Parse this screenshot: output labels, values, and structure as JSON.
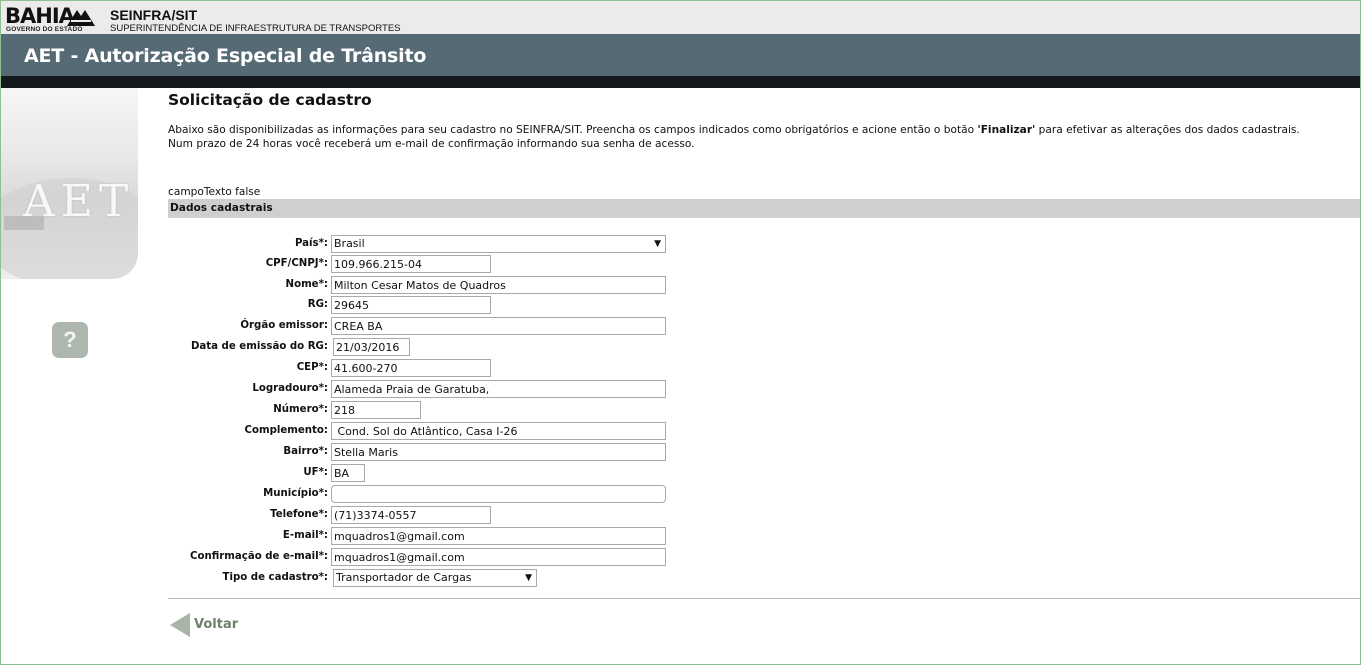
{
  "header": {
    "logo_text": "BAHIA",
    "logo_subtitle": "GOVERNO DO ESTADO",
    "org_name": "SEINFRA/SIT",
    "org_subtitle": "SUPERINTENDÊNCIA DE INFRAESTRUTURA DE TRANSPORTES",
    "app_title": "AET - Autorização Especial de Trânsito"
  },
  "sidebar": {
    "art_text": "AET",
    "help_label": "?"
  },
  "page": {
    "title": "Solicitação de cadastro",
    "intro_part1": "Abaixo são disponibilizadas as informações para seu cadastro no SEINFRA/SIT. Preencha os campos indicados como obrigatórios e acione então o botão ",
    "intro_bold": "'Finalizar'",
    "intro_part2": " para efetivar as alterações dos dados cadastrais.",
    "intro_line2": "Num prazo de 24 horas você receberá um e-mail de confirmação informando sua senha de acesso.",
    "debug_text": "campoTexto false",
    "section_title": "Dados cadastrais"
  },
  "form": {
    "pais": {
      "label": "País*:",
      "value": "Brasil"
    },
    "cpf": {
      "label": "CPF/CNPJ*:",
      "value": "109.966.215-04"
    },
    "nome": {
      "label": "Nome*:",
      "value": "Milton Cesar Matos de Quadros"
    },
    "rg": {
      "label": "RG:",
      "value": "29645"
    },
    "orgao": {
      "label": "Órgão emissor:",
      "value": "CREA BA"
    },
    "data_rg": {
      "label": "Data de emissão do RG:",
      "value": "21/03/2016"
    },
    "cep": {
      "label": "CEP*:",
      "value": "41.600-270"
    },
    "logradouro": {
      "label": "Logradouro*:",
      "value": "Alameda Praia de Garatuba,"
    },
    "numero": {
      "label": "Número*:",
      "value": "218"
    },
    "complemento": {
      "label": "Complemento:",
      "value": " Cond. Sol do Atlântico, Casa I-26"
    },
    "bairro": {
      "label": "Bairro*:",
      "value": "Stella Maris"
    },
    "uf": {
      "label": "UF*:",
      "value": "BA"
    },
    "municipio": {
      "label": "Município*:",
      "value": ""
    },
    "telefone": {
      "label": "Telefone*:",
      "value": "(71)3374-0557"
    },
    "email": {
      "label": "E-mail*:",
      "value": "mquadros1@gmail.com"
    },
    "email_confirm": {
      "label": "Confirmação de e-mail*:",
      "value": "mquadros1@gmail.com"
    },
    "tipo": {
      "label": "Tipo de cadastro*:",
      "value": "Transportador de Cargas"
    }
  },
  "footer": {
    "back_label": "Voltar"
  }
}
